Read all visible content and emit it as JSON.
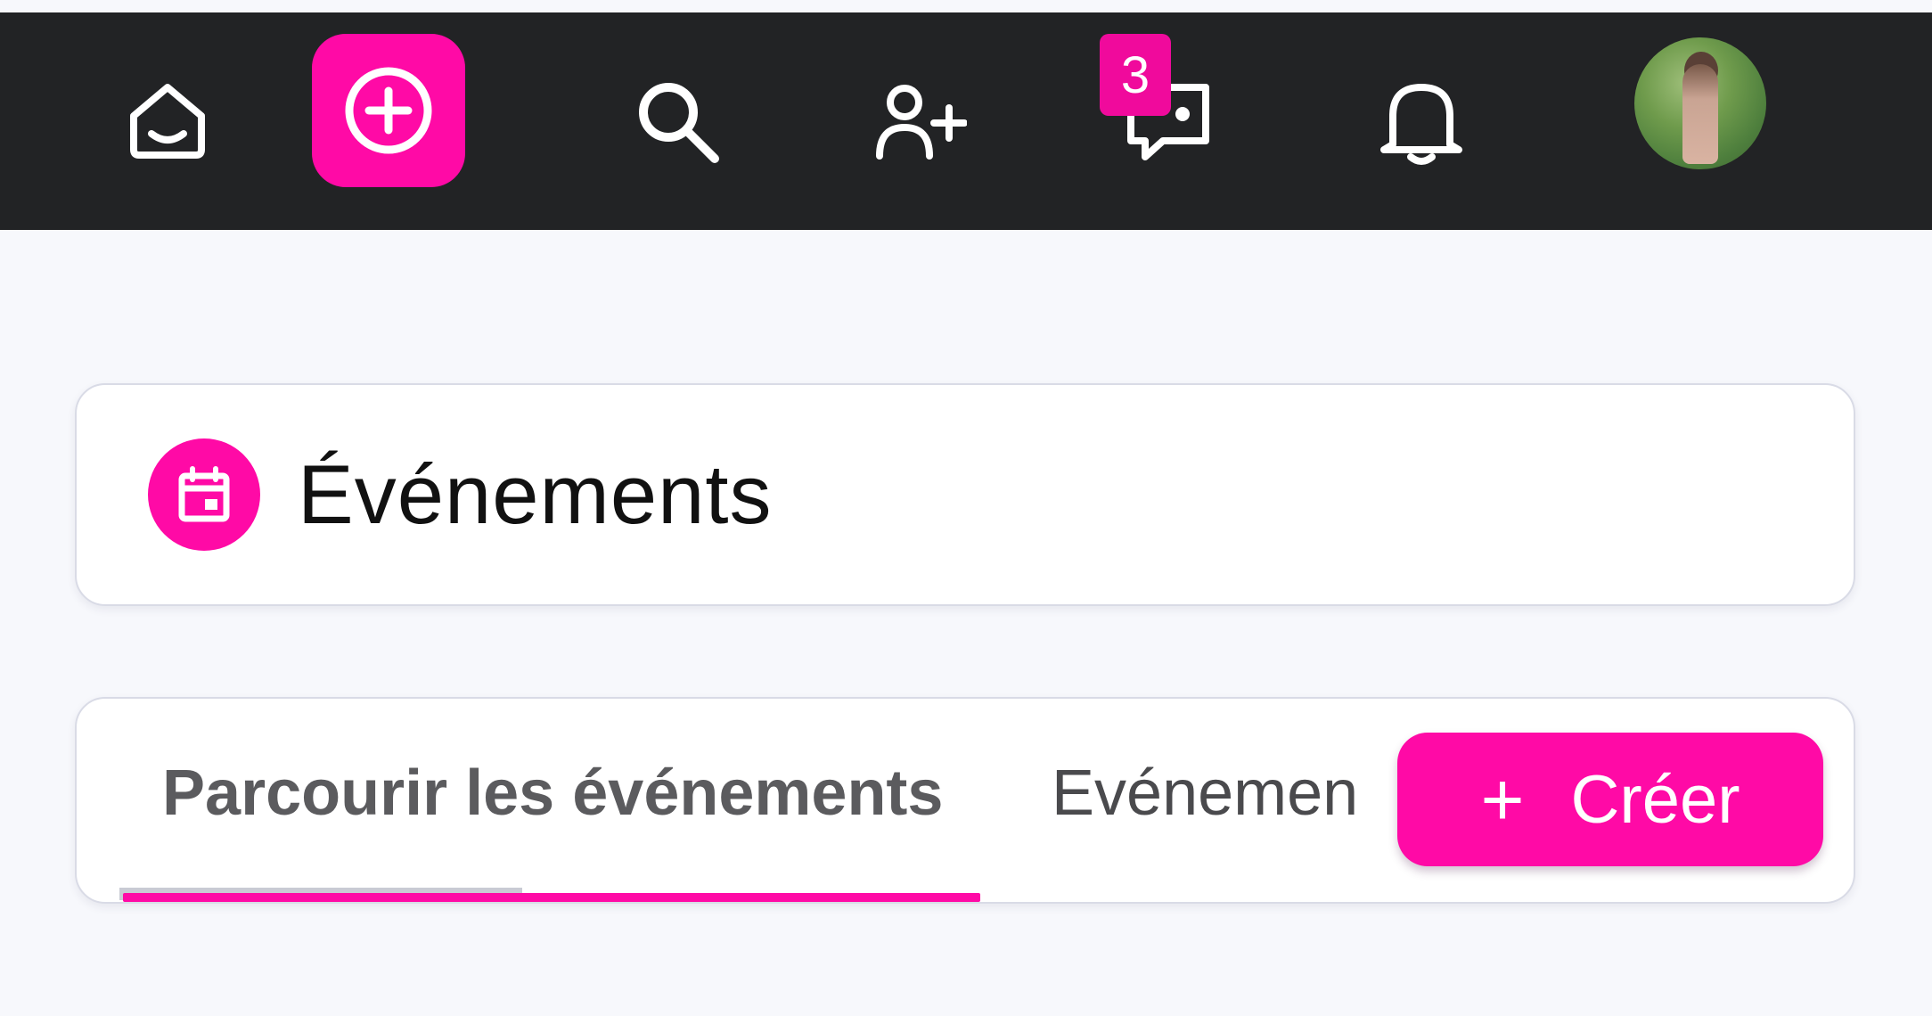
{
  "colors": {
    "accent": "#ff0aa6",
    "topbar": "#222325",
    "background": "#f7f8fc"
  },
  "topnav": {
    "icons": [
      "home-icon",
      "add-circle-icon",
      "search-icon",
      "add-user-icon",
      "chat-icon",
      "bell-icon"
    ],
    "messages_badge": "3"
  },
  "page": {
    "title": "Événements",
    "title_icon": "calendar-icon"
  },
  "tabs": {
    "active_label": "Parcourir les événements",
    "second_label": "Evénemen",
    "create_label": "Créer",
    "create_icon_glyph": "+"
  }
}
